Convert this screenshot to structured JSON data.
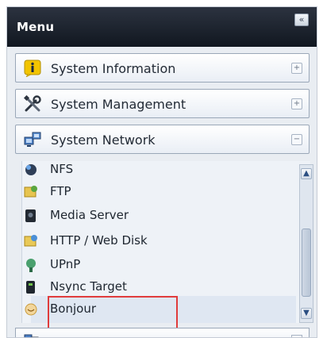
{
  "menu": {
    "title": "Menu",
    "collapse_icon": "«"
  },
  "sections": [
    {
      "label": "System Information",
      "icon": "info-icon",
      "toggle": "+"
    },
    {
      "label": "System Management",
      "icon": "tools-icon",
      "toggle": "+"
    },
    {
      "label": "System Network",
      "icon": "network-icon",
      "toggle": "−"
    }
  ],
  "network_items": [
    {
      "label": "NFS",
      "icon": "nfs-icon"
    },
    {
      "label": "FTP",
      "icon": "ftp-icon"
    },
    {
      "label": "Media Server",
      "icon": "media-server-icon"
    },
    {
      "label": "HTTP / Web Disk",
      "icon": "http-icon"
    },
    {
      "label": "UPnP",
      "icon": "upnp-icon"
    },
    {
      "label": "Nsync Target",
      "icon": "nsync-icon"
    },
    {
      "label": "Bonjour",
      "icon": "bonjour-icon"
    }
  ],
  "scrollbar": {
    "up": "▲",
    "down": "▼"
  },
  "colors": {
    "highlight": "#e03c3c",
    "header": "#1a202a"
  }
}
